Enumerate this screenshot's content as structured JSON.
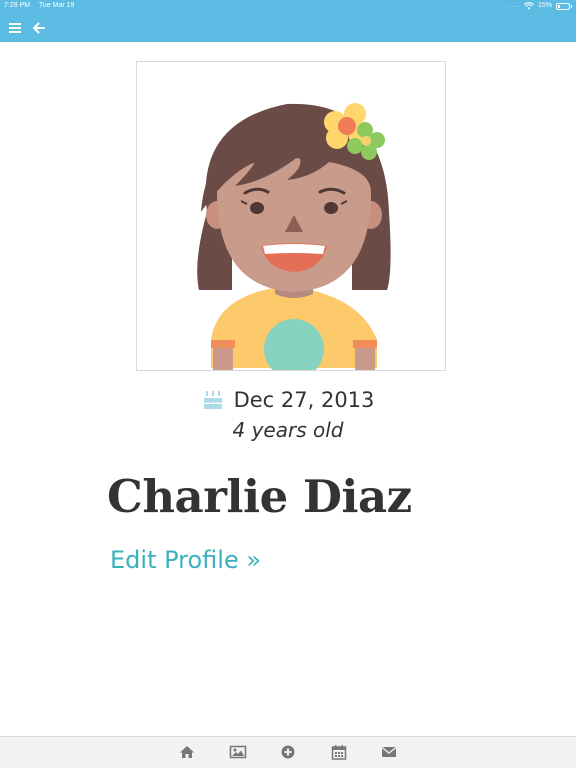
{
  "status_bar": {
    "time": "7:28 PM",
    "date": "Tue Mar 19",
    "signal": "....",
    "battery": "15%"
  },
  "nav": {
    "menu_icon": "hamburger-icon",
    "back_icon": "arrow-left-icon"
  },
  "profile": {
    "photo": "girl-avatar-illustration",
    "birthday_icon": "birthday-cake-icon",
    "birthdate": "Dec 27, 2013",
    "age": "4 years old",
    "name": "Charlie Diaz",
    "edit_link": "Edit Profile »"
  },
  "tabs": [
    {
      "icon": "home-icon"
    },
    {
      "icon": "image-icon"
    },
    {
      "icon": "plus-circle-icon"
    },
    {
      "icon": "calendar-icon"
    },
    {
      "icon": "envelope-icon"
    }
  ],
  "colors": {
    "bar": "#5bbbe3",
    "link": "#3bb0bd",
    "cake": "#a9dce5"
  }
}
